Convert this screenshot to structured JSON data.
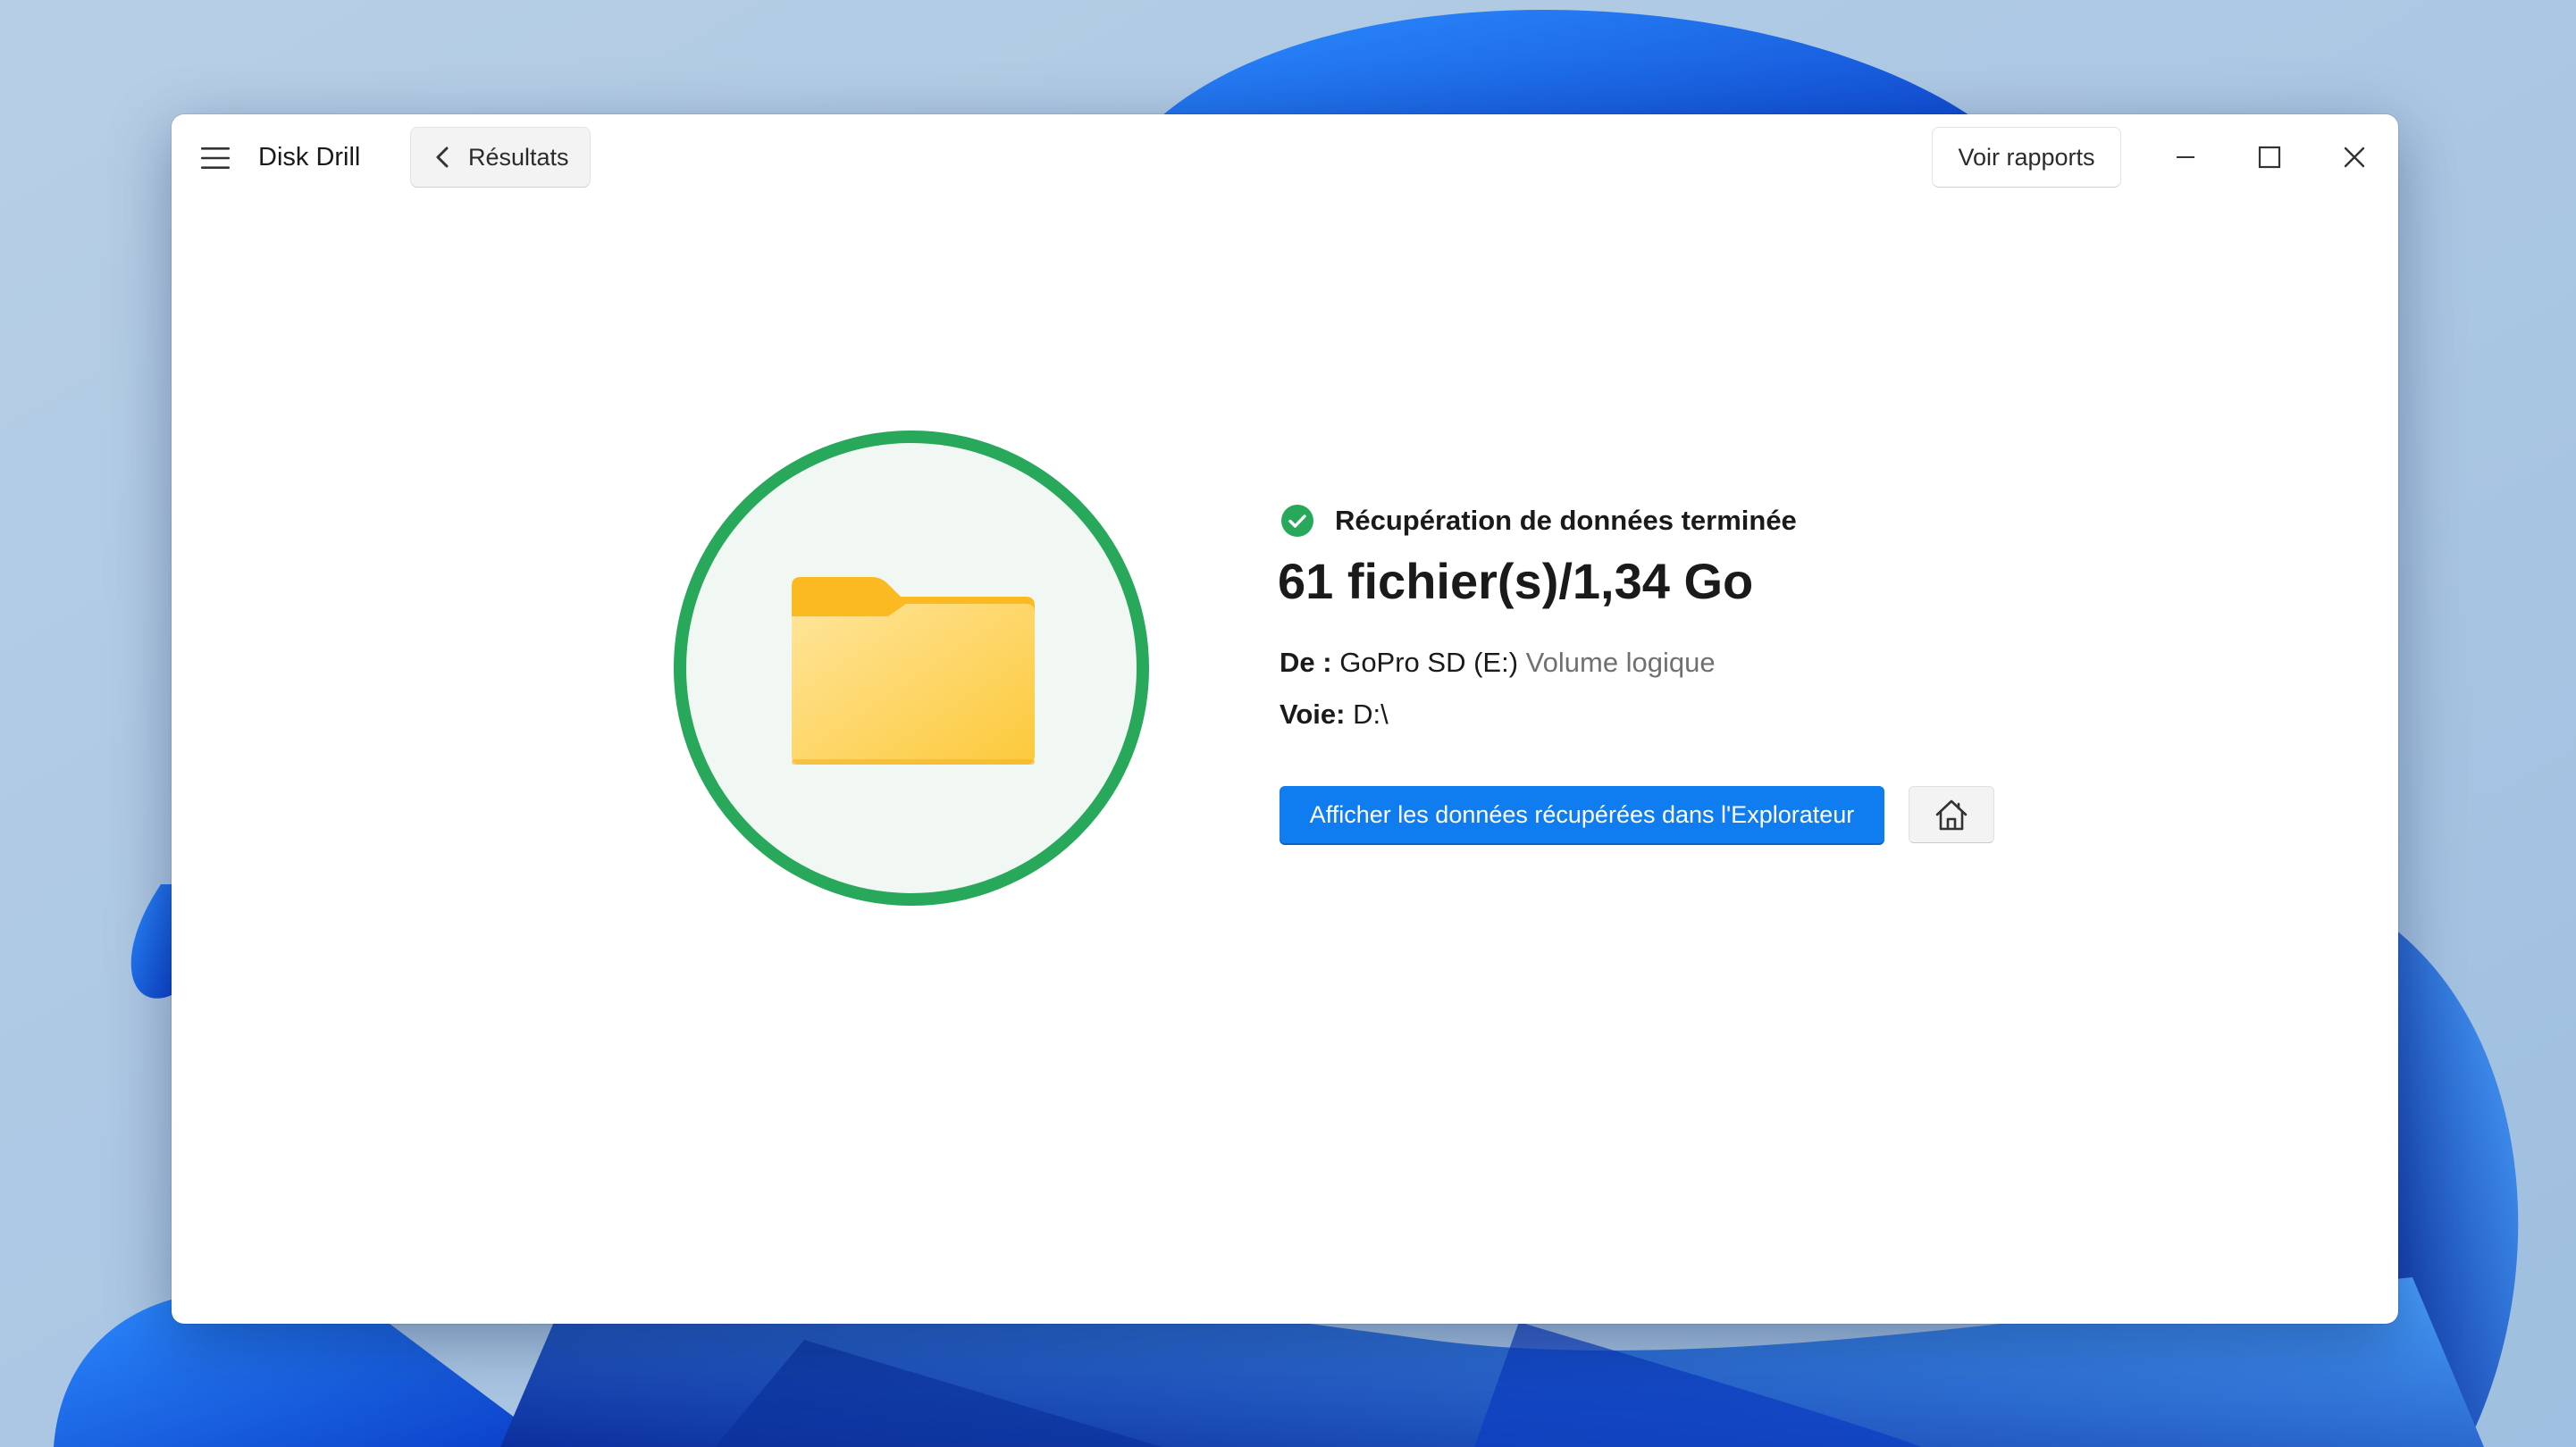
{
  "window": {
    "app_title": "Disk Drill",
    "back_label": "Résultats",
    "reports_label": "Voir rapports"
  },
  "result": {
    "status": "Récupération de données terminée",
    "summary": "61 fichier(s)/1,34 Go",
    "from_label": "De :",
    "from_device": "GoPro SD (E:)",
    "from_type": "Volume logique",
    "path_label": "Voie:",
    "path_value": "D:\\",
    "explorer_button_label": "Afficher les données récupérées dans l'Explorateur"
  },
  "icons": {
    "menu": "hamburger-menu-icon",
    "back": "chevron-left-icon",
    "minimize": "minimize-icon",
    "maximize": "maximize-icon",
    "close": "close-icon",
    "status": "check-circle-icon",
    "result": "folder-icon",
    "home": "home-icon"
  },
  "colors": {
    "accent": "#0f7cf0",
    "success": "#28a85a",
    "folder": "#fcc93a"
  }
}
